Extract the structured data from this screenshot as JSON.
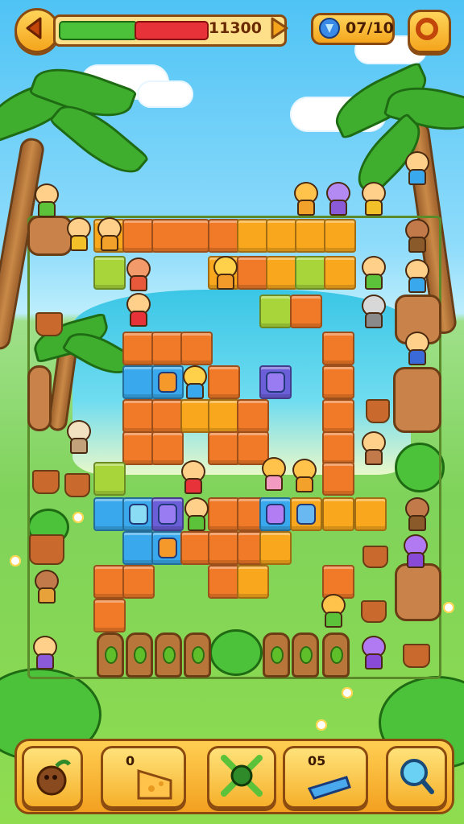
{
  "hud": {
    "back_icon": "back-arrow-icon",
    "score": "11300",
    "progress_green": 0.34,
    "progress_red": 0.32,
    "gem_counter": "07/10",
    "gem_icon": "blue-gem-icon",
    "settings_icon": "ring-icon"
  },
  "boosters": [
    {
      "name": "coconut-booster",
      "icon": "coconut-icon",
      "label": ""
    },
    {
      "name": "cheese-booster",
      "icon": "cheese-icon",
      "label": "0"
    },
    {
      "name": "swords-booster",
      "icon": "crossed-swords-icon",
      "label": ""
    },
    {
      "name": "whistle-booster",
      "icon": "whistle-icon",
      "label": "05"
    },
    {
      "name": "magnifier-booster",
      "icon": "magnifier-icon",
      "label": ""
    }
  ],
  "colors": {
    "orange": "#f07a28",
    "yellow": "#f9a81d",
    "lime": "#a8d63a",
    "blue": "#3aa8ec",
    "green_bar": "#4cc23a",
    "red_bar": "#e8323a"
  }
}
